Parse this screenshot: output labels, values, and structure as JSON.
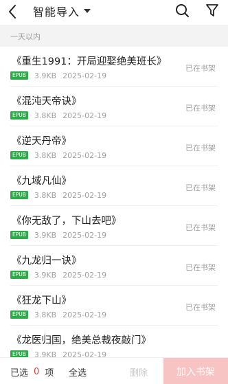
{
  "header": {
    "title": "智能导入",
    "icons": {
      "back": "chevron-left-icon",
      "caret": "caret-down-icon",
      "search": "search-icon",
      "filter": "filter-icon"
    }
  },
  "section": {
    "label": "一天以内"
  },
  "books": [
    {
      "title": "《重生1991：开局迎娶绝美班长》",
      "format": "EPUB",
      "size": "3.9KB",
      "date": "2025-02-19",
      "status": "已在书架"
    },
    {
      "title": "《混沌天帝诀》",
      "format": "EPUB",
      "size": "3.8KB",
      "date": "2025-02-19",
      "status": "已在书架"
    },
    {
      "title": "《逆天丹帝》",
      "format": "EPUB",
      "size": "3.8KB",
      "date": "2025-02-19",
      "status": "已在书架"
    },
    {
      "title": "《九域凡仙》",
      "format": "EPUB",
      "size": "3.8KB",
      "date": "2025-02-19",
      "status": "已在书架"
    },
    {
      "title": "《你无敌了，下山去吧》",
      "format": "EPUB",
      "size": "3.9KB",
      "date": "2025-02-19",
      "status": "已在书架"
    },
    {
      "title": "《九龙归一诀》",
      "format": "EPUB",
      "size": "3.9KB",
      "date": "2025-02-19",
      "status": "已在书架"
    },
    {
      "title": "《狂龙下山》",
      "format": "EPUB",
      "size": "3.8KB",
      "date": "2025-02-19",
      "status": "已在书架"
    },
    {
      "title": "《龙医归国，绝美总裁夜敲门》",
      "format": "EPUB",
      "size": "3.9KB",
      "date": "2025-02-19",
      "status": ""
    }
  ],
  "footer": {
    "selected_prefix": "已选",
    "selected_count": "0",
    "selected_suffix": "项",
    "select_all": "全选",
    "delete": "删除",
    "add_to_shelf": "加入书架"
  },
  "colors": {
    "badge": "#2eaa4a",
    "count": "#e33b3b",
    "add_button": "#f7c3c3"
  }
}
